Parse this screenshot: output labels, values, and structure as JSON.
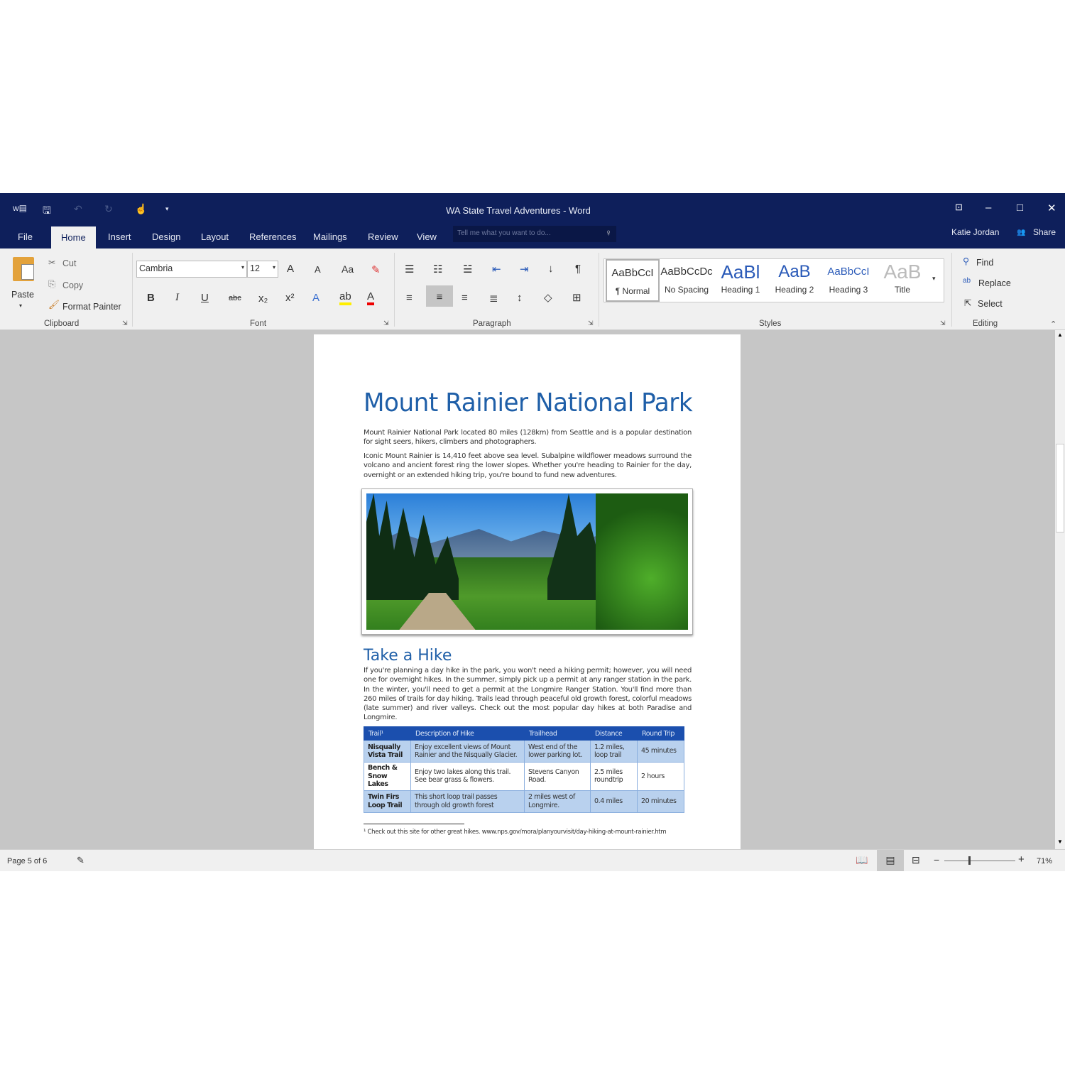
{
  "window": {
    "title": "WA State Travel Adventures - Word",
    "user": "Katie Jordan",
    "share": "Share",
    "colors": {
      "titlebar": "#0e1f5b",
      "accent": "#1f5fa8",
      "table_header": "#1b4fae",
      "table_band": "#b9d1ee"
    }
  },
  "tabs": [
    "File",
    "Home",
    "Insert",
    "Design",
    "Layout",
    "References",
    "Mailings",
    "Review",
    "View"
  ],
  "active_tab": "Home",
  "tell_me": {
    "placeholder": "Tell me what you want to do..."
  },
  "clipboard": {
    "paste": "Paste",
    "cut": "Cut",
    "copy": "Copy",
    "format_painter": "Format Painter",
    "label": "Clipboard"
  },
  "font": {
    "name": "Cambria",
    "size": "12",
    "label": "Font",
    "bold": "B",
    "italic": "I",
    "underline": "U",
    "strike": "abc",
    "grow": "A",
    "shrink": "A",
    "case": "Aa"
  },
  "paragraph": {
    "label": "Paragraph",
    "pilcrow": "¶"
  },
  "styles": {
    "label": "Styles",
    "items": [
      {
        "preview": "AaBbCcI",
        "name": "¶ Normal"
      },
      {
        "preview": "AaBbCcDc",
        "name": "No Spacing"
      },
      {
        "preview": "AaBl",
        "name": "Heading 1"
      },
      {
        "preview": "AaB",
        "name": "Heading 2"
      },
      {
        "preview": "AaBbCcI",
        "name": "Heading 3"
      },
      {
        "preview": "AaB",
        "name": "Title"
      }
    ]
  },
  "editing": {
    "label": "Editing",
    "find": "Find",
    "replace": "Replace",
    "select": "Select"
  },
  "document": {
    "title": "Mount Rainier National Park",
    "para1": "Mount Rainier National Park located 80 miles (128km) from Seattle and is a popular destination for sight seers, hikers, climbers and photographers.",
    "para2": "Iconic Mount Rainier is 14,410 feet above sea level. Subalpine wildflower meadows surround the volcano and ancient forest ring the lower slopes. Whether you're heading to Rainier for the day, overnight or an extended hiking trip, you're bound to fund new adventures.",
    "heading2": "Take a Hike",
    "para3": "If you're planning a day hike in the park, you won't need a hiking permit; however, you will need one for overnight hikes. In the summer, simply pick up a permit at any ranger station in the park. In the winter, you'll need to get a permit at the Longmire Ranger Station. You'll find more than 260 miles of trails for day hiking. Trails lead through peaceful old growth forest, colorful meadows (late summer) and river valleys. Check out the most popular day hikes at both Paradise and Longmire.",
    "table": {
      "headers": [
        "Trail¹",
        "Description of Hike",
        "Trailhead",
        "Distance",
        "Round Trip"
      ],
      "rows": [
        [
          "Nisqually Vista Trail",
          "Enjoy excellent views of Mount Rainier and the Nisqually Glacier.",
          "West end of the lower parking lot.",
          "1.2 miles, loop trail",
          "45 minutes"
        ],
        [
          "Bench & Snow Lakes",
          "Enjoy two lakes along this trail. See bear grass & flowers.",
          "Stevens Canyon Road.",
          "2.5 miles roundtrip",
          "2 hours"
        ],
        [
          "Twin Firs Loop Trail",
          "This short loop trail passes through old growth forest",
          "2 miles west of Longmire.",
          "0.4 miles",
          "20 minutes"
        ]
      ]
    },
    "footnote": "¹ Check out this site for other great hikes. www.nps.gov/mora/planyourvisit/day-hiking-at-mount-rainier.htm"
  },
  "status": {
    "page": "Page 5 of 6",
    "zoom": "71%",
    "zoom_level": 0.71
  }
}
